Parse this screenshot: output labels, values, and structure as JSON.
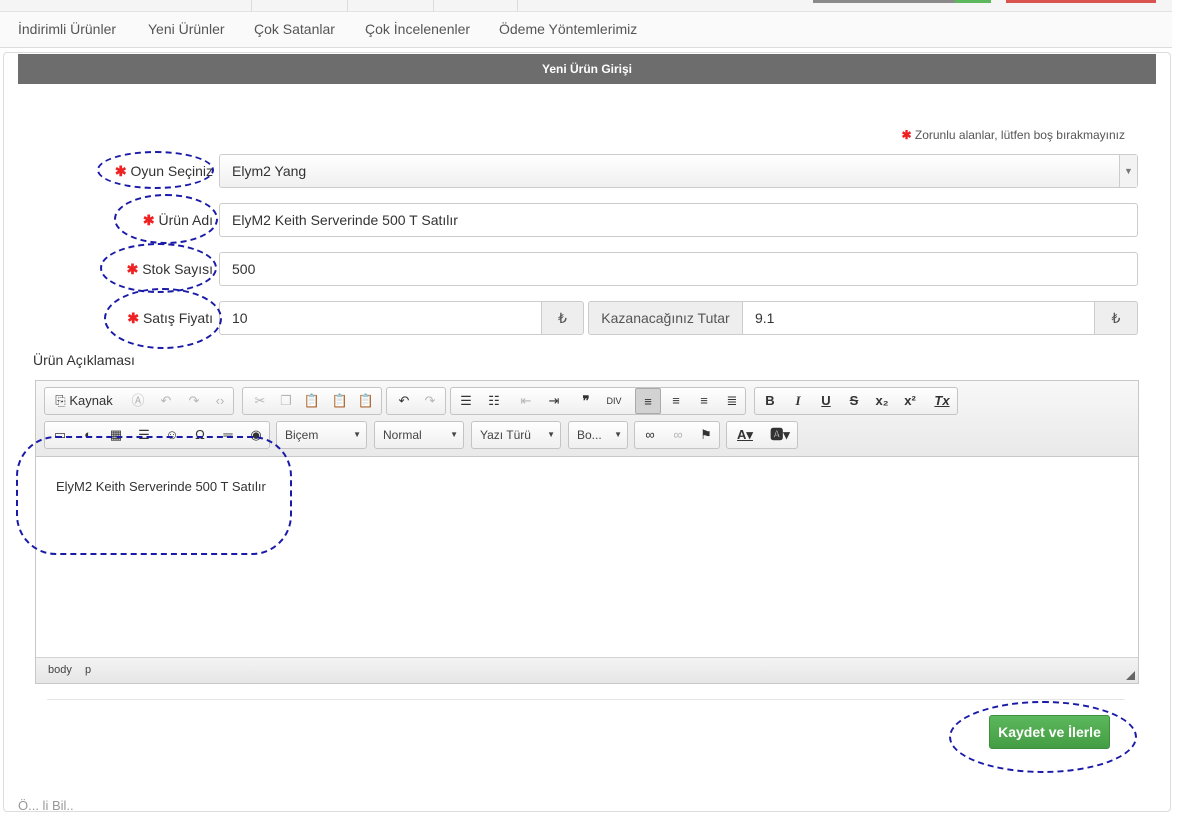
{
  "nav": {
    "items": [
      "İndirimli Ürünler",
      "Yeni Ürünler",
      "Çok Satanlar",
      "Çok İncelenenler",
      "Ödeme Yöntemlerimiz"
    ]
  },
  "panel": {
    "title": "Yeni Ürün Girişi",
    "required_note": "Zorunlu alanlar, lütfen boş bırakmayınız"
  },
  "form": {
    "game": {
      "label": "Oyun Seçiniz",
      "value": "Elym2 Yang"
    },
    "product_name": {
      "label": "Ürün Adı",
      "value": "ElyM2 Keith Serverinde 500 T Satılır"
    },
    "stock": {
      "label": "Stok Sayısı",
      "value": "500"
    },
    "price": {
      "label": "Satış Fiyatı",
      "value": "10",
      "currency": "₺"
    },
    "earnings": {
      "label": "Kazanacağınız Tutar",
      "value": "9.1",
      "currency": "₺"
    },
    "description_label": "Ürün Açıklaması"
  },
  "editor": {
    "source_label": "Kaynak",
    "combos": {
      "format": "Biçem",
      "paragraph": "Normal",
      "font": "Yazı Türü",
      "size": "Bo..."
    },
    "content": "ElyM2 Keith Serverinde 500 T Satılır",
    "path": [
      "body",
      "p"
    ]
  },
  "actions": {
    "save_label": "Kaydet ve İlerle"
  },
  "colors": {
    "header_bg": "#6d6d6d",
    "save_green": "#4cae4c",
    "required_star": "#e22222",
    "annotation": "#1a1aa8"
  }
}
